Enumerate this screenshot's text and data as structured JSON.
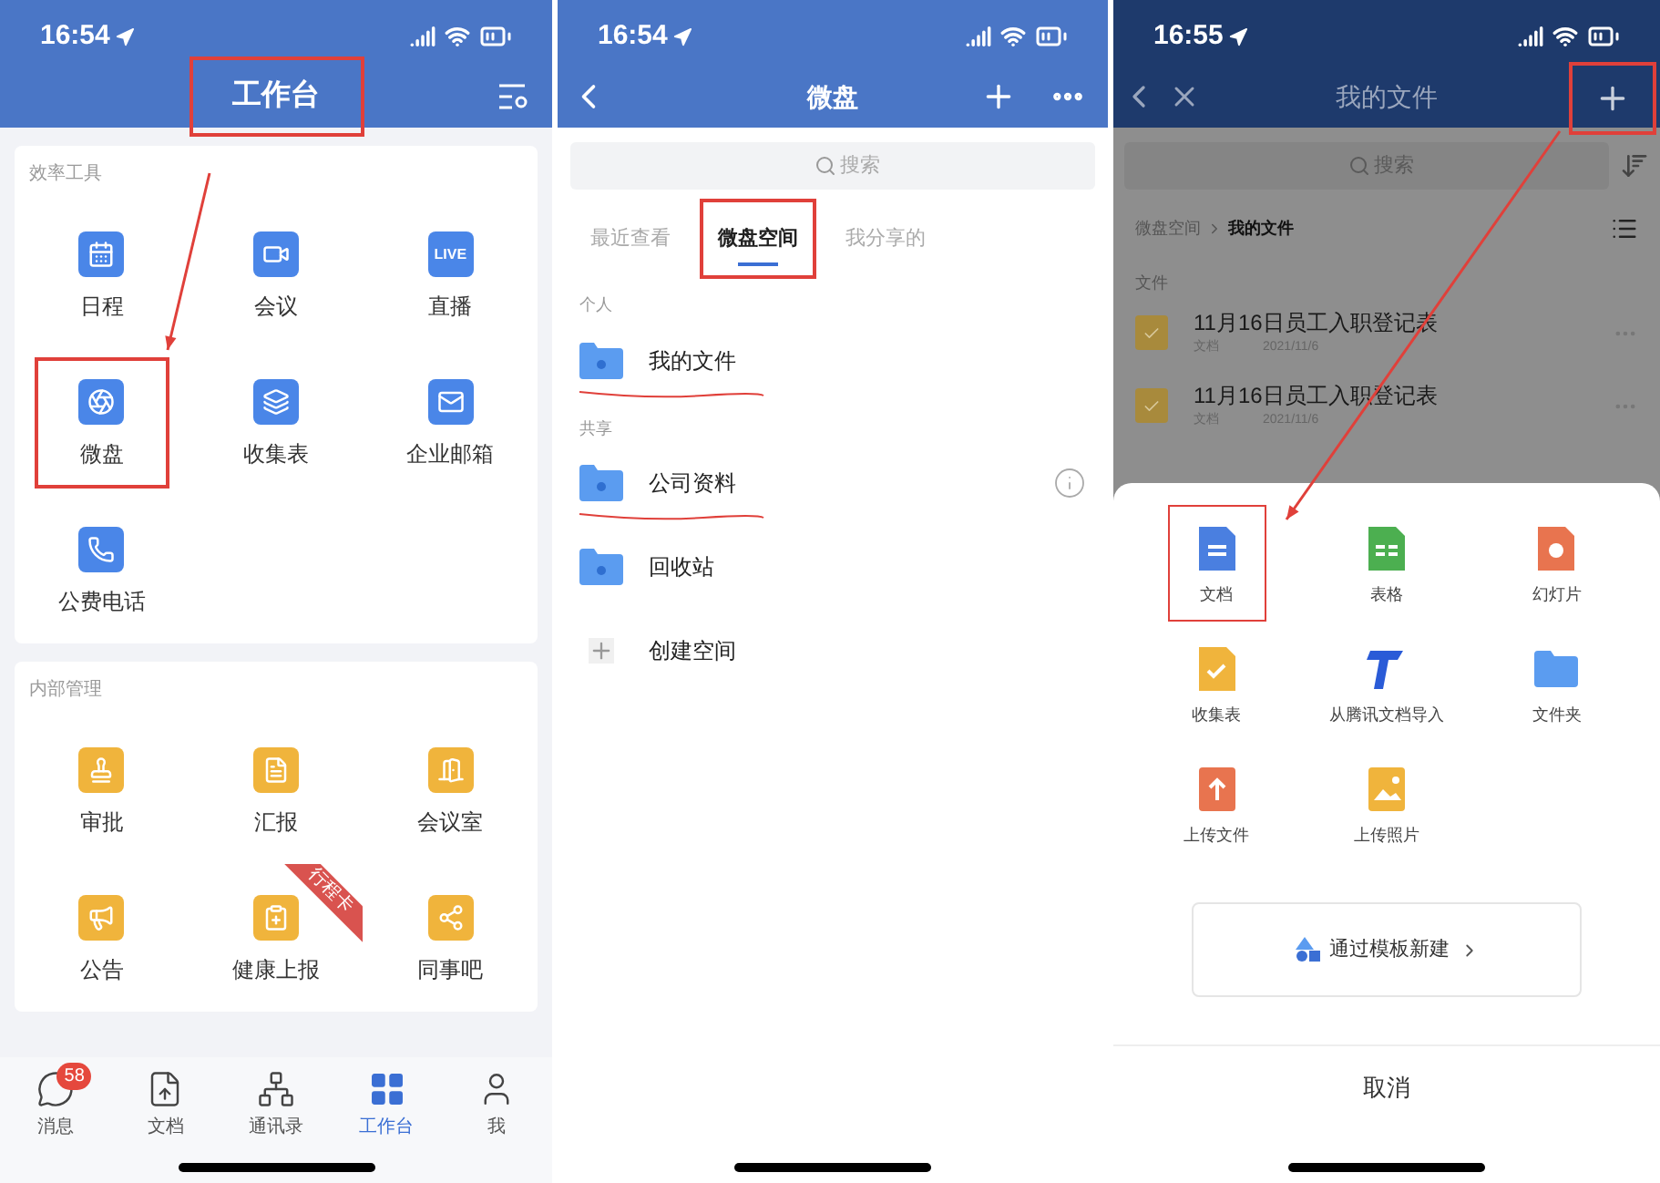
{
  "workbench": {
    "status_time": "16:54",
    "title": "工作台",
    "title_highlighted": true,
    "arrow": true,
    "sections": [
      {
        "title": "效率工具",
        "color": "#4a86e8",
        "items": [
          {
            "label": "日程",
            "highlighted": false
          },
          {
            "label": "会议",
            "highlighted": false
          },
          {
            "label": "直播",
            "icon_text": "LIVE",
            "highlighted": false
          },
          {
            "label": "微盘",
            "highlighted": true
          },
          {
            "label": "收集表",
            "highlighted": false
          },
          {
            "label": "企业邮箱",
            "highlighted": false
          },
          {
            "label": "公费电话",
            "highlighted": false
          }
        ]
      },
      {
        "title": "内部管理",
        "color": "#f0b43c",
        "items": [
          {
            "label": "审批",
            "highlighted": false
          },
          {
            "label": "汇报",
            "highlighted": false
          },
          {
            "label": "会议室",
            "highlighted": false
          },
          {
            "label": "公告",
            "highlighted": false
          },
          {
            "label": "健康上报",
            "ribbon": "行程卡",
            "highlighted": false
          },
          {
            "label": "同事吧",
            "highlighted": false
          }
        ]
      }
    ],
    "tabbar": [
      {
        "label": "消息",
        "badge": "58",
        "selected": false
      },
      {
        "label": "文档",
        "selected": false
      },
      {
        "label": "通讯录",
        "selected": false
      },
      {
        "label": "工作台",
        "selected": true
      },
      {
        "label": "我",
        "selected": false
      }
    ]
  },
  "drive": {
    "status_time": "16:54",
    "title": "微盘",
    "search_placeholder": "搜索",
    "tabs": [
      {
        "label": "最近查看",
        "selected": false,
        "highlighted": false
      },
      {
        "label": "微盘空间",
        "selected": true,
        "highlighted": true
      },
      {
        "label": "我分享的",
        "selected": false,
        "highlighted": false
      }
    ],
    "groups": [
      {
        "title": "个人",
        "rows": [
          {
            "label": "我的文件",
            "underlined": true,
            "info": false
          }
        ]
      },
      {
        "title": "共享",
        "rows": [
          {
            "label": "公司资料",
            "underlined": true,
            "info": true
          },
          {
            "label": "回收站",
            "underlined": false,
            "info": false
          }
        ]
      }
    ],
    "create": "创建空间"
  },
  "my_files": {
    "status_time": "16:55",
    "title": "我的文件",
    "add_highlighted": true,
    "arrow": true,
    "search_placeholder": "搜索",
    "breadcrumb": [
      "微盘空间",
      "我的文件"
    ],
    "section": "文件",
    "files": [
      {
        "name": "11月16日员工入职登记表",
        "type": "文档",
        "date": "2021/11/6"
      },
      {
        "name": "11月16日员工入职登记表",
        "type": "文档",
        "date": "2021/11/6"
      }
    ],
    "sheet": {
      "items": [
        {
          "label": "文档",
          "color": "#4a7fe0",
          "highlighted": true
        },
        {
          "label": "表格",
          "color": "#4caf50",
          "highlighted": false
        },
        {
          "label": "幻灯片",
          "color": "#e8744f",
          "highlighted": false
        },
        {
          "label": "收集表",
          "color": "#f0b43c",
          "highlighted": false
        },
        {
          "label": "从腾讯文档导入",
          "color": "#2a5bd7",
          "highlighted": false
        },
        {
          "label": "文件夹",
          "color": "#5b9cf0",
          "highlighted": false
        },
        {
          "label": "上传文件",
          "color": "#e8744f",
          "highlighted": false
        },
        {
          "label": "上传照片",
          "color": "#f0b43c",
          "highlighted": false
        }
      ],
      "template": "通过模板新建",
      "cancel": "取消"
    }
  }
}
